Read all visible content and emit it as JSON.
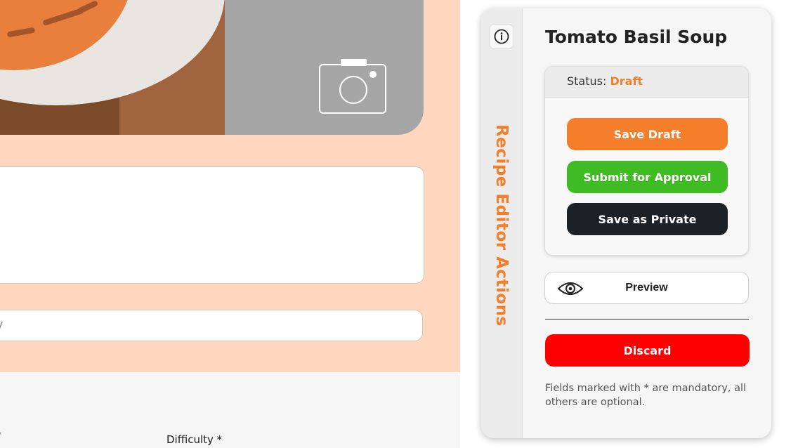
{
  "editor": {
    "hero_image_alt": "Tomato basil soup",
    "camera_icon": "camera-icon",
    "input_placeholder_fragment": "y",
    "difficulty_label": "Difficulty *",
    "edge_fragment": "*"
  },
  "panel": {
    "info_icon": "info-icon",
    "rail_title": "Recipe Editor Actions",
    "recipe_title": "Tomato Basil Soup",
    "status_label": "Status:",
    "status_value": "Draft",
    "save_draft_label": "Save Draft",
    "submit_label": "Submit for Approval",
    "private_label": "Save as Private",
    "preview_label": "Preview",
    "preview_icon": "eye-icon",
    "discard_label": "Discard",
    "footnote": "Fields marked with * are mandatory, all others are optional."
  },
  "colors": {
    "accent_orange": "#f47e2a",
    "approve_green": "#3fbc23",
    "private_dark": "#1c2126",
    "discard_red": "#ff0000",
    "editor_background": "#ffd6be"
  }
}
